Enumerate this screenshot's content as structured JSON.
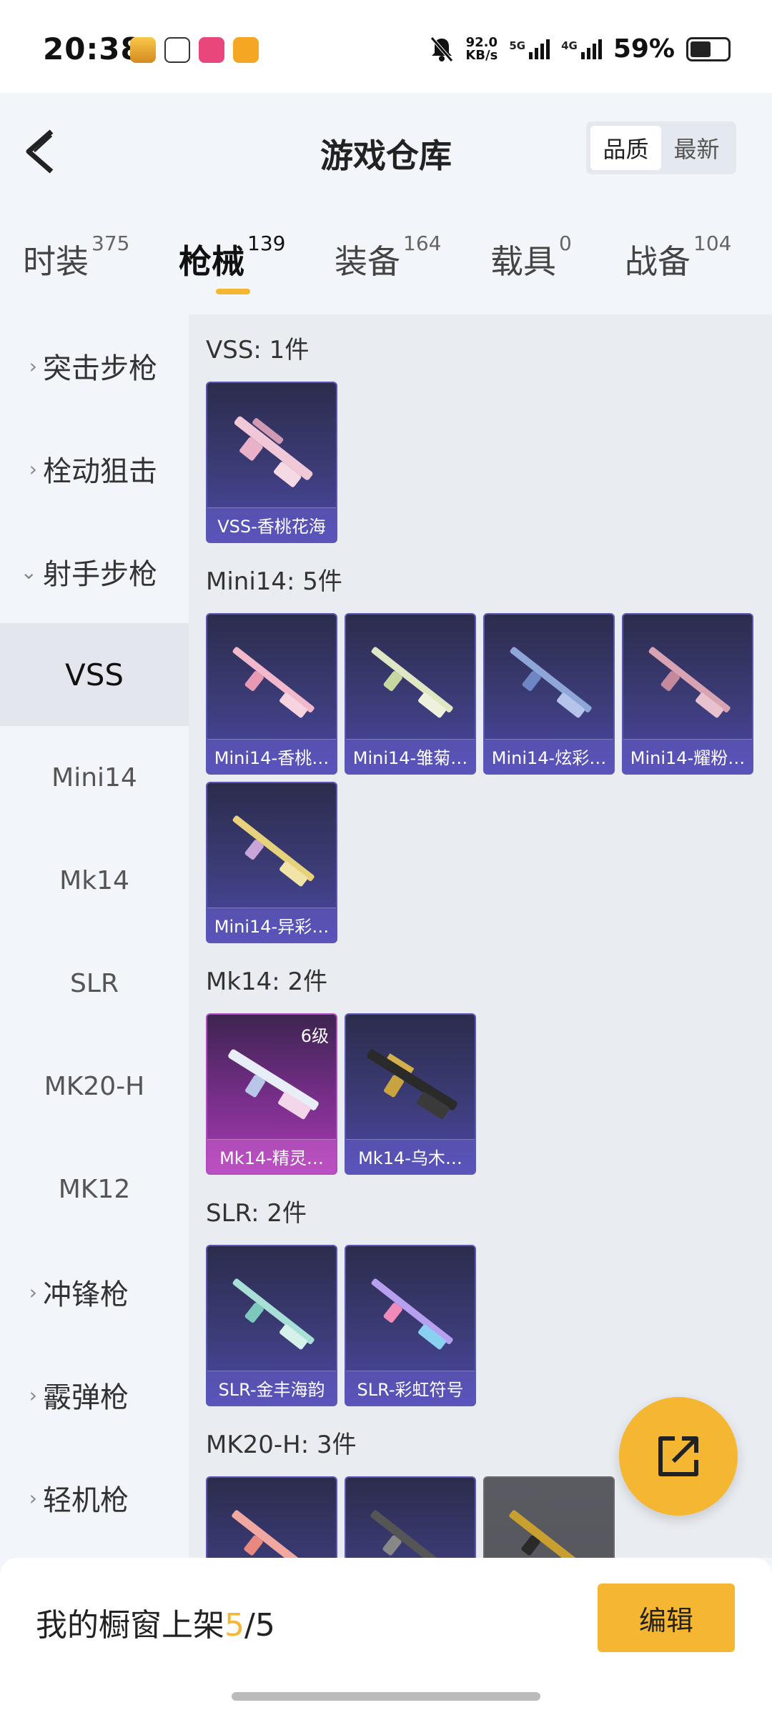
{
  "status_bar": {
    "time": "20:38",
    "speed_value": "92.0",
    "speed_unit": "KB/s",
    "net1": "5G",
    "net2": "4G",
    "battery": "59%",
    "icons": [
      "app-icon-1",
      "app-icon-2",
      "app-icon-3",
      "app-icon-4",
      "mute-icon",
      "signal-icon",
      "battery-icon"
    ]
  },
  "header": {
    "title": "游戏仓库",
    "sort": [
      "品质",
      "最新"
    ],
    "active_sort": "品质"
  },
  "tabs": [
    {
      "label": "时装",
      "count": "375"
    },
    {
      "label": "枪械",
      "count": "139"
    },
    {
      "label": "装备",
      "count": "164"
    },
    {
      "label": "载具",
      "count": "0"
    },
    {
      "label": "战备",
      "count": "104"
    }
  ],
  "sidebar": {
    "categories": [
      {
        "label": "突击步枪",
        "chevron": "›"
      },
      {
        "label": "栓动狙击",
        "chevron": "›"
      },
      {
        "label": "射手步枪",
        "chevron": "⌄"
      },
      {
        "label": "冲锋枪",
        "chevron": "›"
      },
      {
        "label": "霰弹枪",
        "chevron": "›"
      },
      {
        "label": "轻机枪",
        "chevron": "›"
      }
    ],
    "subitems": [
      "VSS",
      "Mini14",
      "Mk14",
      "SLR",
      "MK20-H",
      "MK12"
    ]
  },
  "groups": [
    {
      "title": "VSS: 1件",
      "items": [
        {
          "name": "VSS-香桃花海"
        }
      ]
    },
    {
      "title": "Mini14: 5件",
      "items": [
        {
          "name": "Mini14-香桃…"
        },
        {
          "name": "Mini14-雏菊…"
        },
        {
          "name": "Mini14-炫彩…"
        },
        {
          "name": "Mini14-耀粉…"
        },
        {
          "name": "Mini14-异彩…"
        }
      ]
    },
    {
      "title": "Mk14: 2件",
      "items": [
        {
          "name": "Mk14-精灵…",
          "level": "6级"
        },
        {
          "name": "Mk14-乌木…"
        }
      ]
    },
    {
      "title": "SLR: 2件",
      "items": [
        {
          "name": "SLR-金丰海韵"
        },
        {
          "name": "SLR-彩虹符号"
        }
      ]
    },
    {
      "title": "MK20-H: 3件",
      "items": []
    }
  ],
  "bottom": {
    "showcase_label": "我的橱窗上架",
    "current": "5",
    "separator": "/",
    "total": "5",
    "edit_label": "编辑"
  },
  "colors": {
    "accent": "#f5b731",
    "card_blue": "#3c3c78",
    "card_pink": "#a63bb0"
  }
}
